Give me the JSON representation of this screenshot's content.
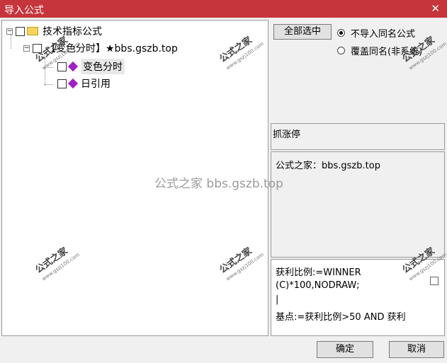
{
  "window": {
    "title": "导入公式",
    "close_glyph": "✕"
  },
  "tree": {
    "root_label": "技术指标公式",
    "group_label": "【变色分时】★bbs.gszb.top",
    "items": [
      {
        "label": "变色分时"
      },
      {
        "label": "日引用"
      }
    ]
  },
  "options": {
    "select_all_label": "全部选中",
    "radio_skip_label": "不导入同名公式",
    "radio_overwrite_label": "覆盖同名(非系统)"
  },
  "info": {
    "name_text": "抓涨停",
    "desc_text": "公式之家：bbs.gszb.top"
  },
  "code": {
    "lines": [
      "获利比例:=WINNER",
      "(C)*100,NODRAW;",
      "|",
      "基点:=获利比例>50 AND 获利"
    ]
  },
  "footer": {
    "ok_label": "确定",
    "cancel_label": "取消"
  },
  "watermark": {
    "center_text": "公式之家 bbs.gszb.top",
    "stamp_text": "公式之家",
    "stamp_url": "www.gszj100.com"
  },
  "colors": {
    "titlebar": "#c6353b",
    "dialog_bg": "#f0f0f0"
  }
}
